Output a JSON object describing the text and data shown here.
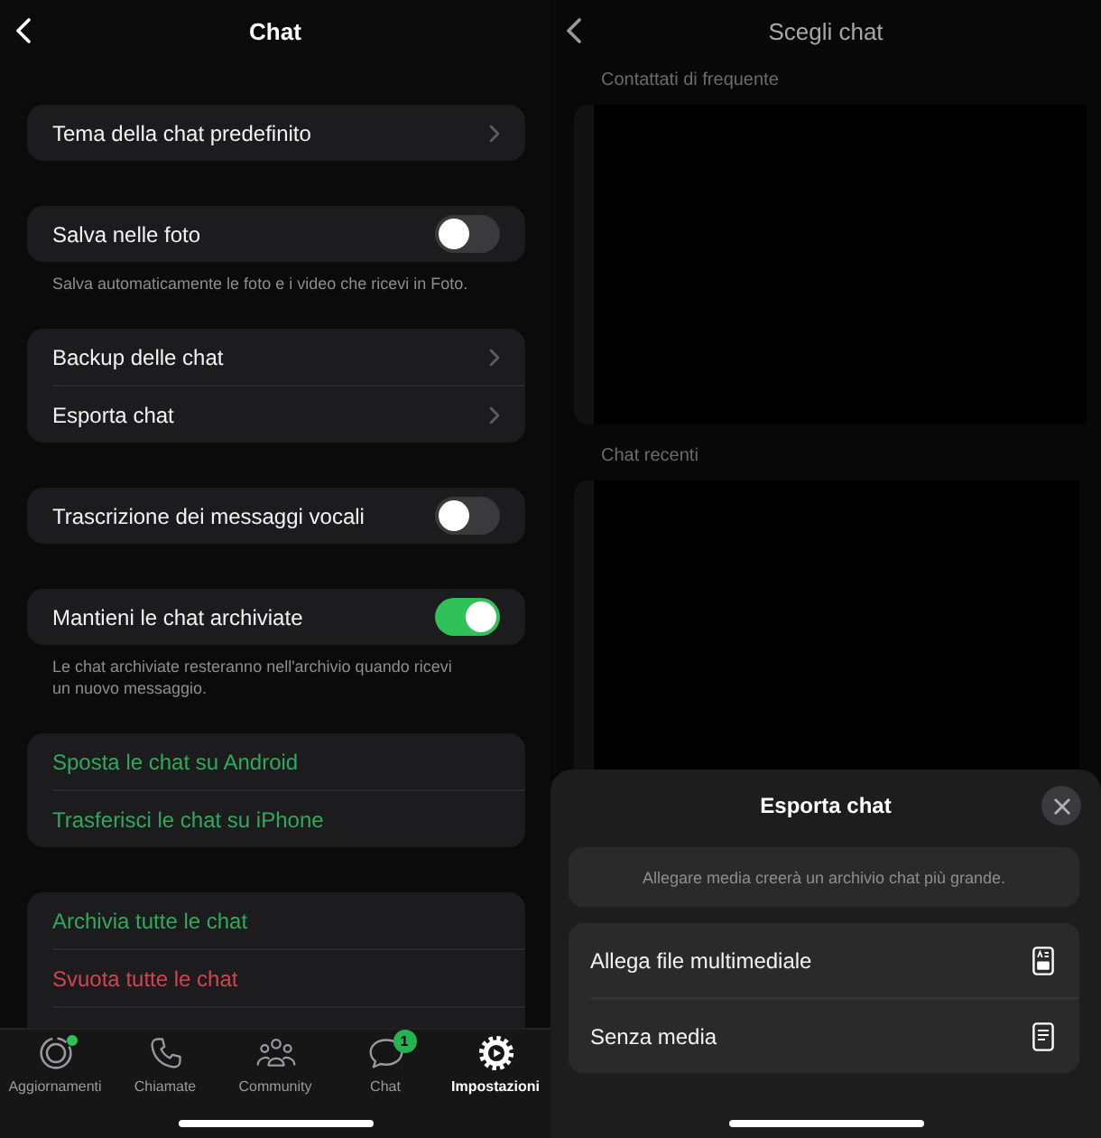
{
  "settings": {
    "title": "Chat",
    "groups": [
      {
        "rows": [
          {
            "kind": "link",
            "label": "Tema della chat predefinito"
          }
        ]
      },
      {
        "rows": [
          {
            "kind": "toggle",
            "label": "Salva nelle foto",
            "on": false
          }
        ],
        "footer": "Salva automaticamente le foto e i video che ricevi in Foto."
      },
      {
        "rows": [
          {
            "kind": "link",
            "label": "Backup delle chat"
          },
          {
            "kind": "link",
            "label": "Esporta chat"
          }
        ]
      },
      {
        "rows": [
          {
            "kind": "toggle",
            "label": "Trascrizione dei messaggi vocali",
            "on": false
          }
        ]
      },
      {
        "rows": [
          {
            "kind": "toggle",
            "label": "Mantieni le chat archiviate",
            "on": true
          }
        ],
        "footer": "Le chat archiviate resteranno nell'archivio quando ricevi un nuovo messaggio."
      },
      {
        "rows": [
          {
            "kind": "action",
            "label": "Sposta le chat su Android",
            "color": "#32a85c"
          },
          {
            "kind": "action",
            "label": "Trasferisci le chat su iPhone",
            "color": "#32a85c"
          }
        ]
      },
      {
        "rows": [
          {
            "kind": "action",
            "label": "Archivia tutte le chat",
            "color": "#32a85c"
          },
          {
            "kind": "action",
            "label": "Svuota tutte le chat",
            "color": "#d0454f"
          }
        ]
      }
    ],
    "tab_bar": [
      {
        "label": "Aggiornamenti",
        "selected": false,
        "unread": true
      },
      {
        "label": "Chiamate",
        "selected": false,
        "unread": false
      },
      {
        "label": "Community",
        "selected": false,
        "unread": false
      },
      {
        "label": "Chat",
        "selected": false,
        "unread": false,
        "badge": "1"
      },
      {
        "label": "Impostazioni",
        "selected": true,
        "unread": false
      }
    ]
  },
  "choose_chat": {
    "title": "Scegli chat",
    "sections": [
      {
        "label": "Contattati di frequente"
      },
      {
        "label": "Chat recenti"
      }
    ],
    "sheet": {
      "title": "Esporta chat",
      "note": "Allegare media creerà un archivio chat più grande.",
      "options": [
        {
          "label": "Allega file multimediale"
        },
        {
          "label": "Senza media"
        }
      ]
    }
  }
}
